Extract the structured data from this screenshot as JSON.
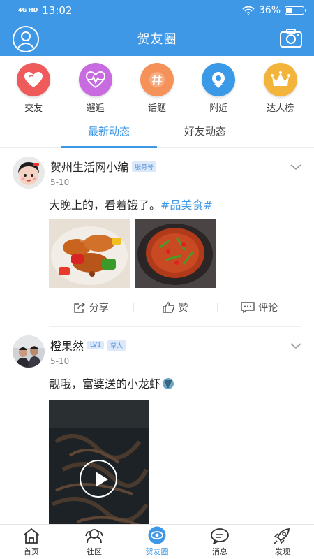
{
  "status_bar": {
    "network": "4G HD",
    "time": "13:02",
    "battery": "36%",
    "battery_level": 0.36
  },
  "header": {
    "title": "贺友圈",
    "profile_icon": "user-circle-icon",
    "camera_icon": "camera-icon"
  },
  "categories": [
    {
      "label": "交友",
      "icon": "heart-icon",
      "color": "#ef5a5a"
    },
    {
      "label": "邂逅",
      "icon": "heartbeat-icon",
      "color": "#c86be0"
    },
    {
      "label": "话题",
      "icon": "hashtag-icon",
      "color": "#f5925a"
    },
    {
      "label": "附近",
      "icon": "location-icon",
      "color": "#3a9ae8"
    },
    {
      "label": "达人榜",
      "icon": "crown-icon",
      "color": "#f3b43b"
    }
  ],
  "tabs": [
    {
      "label": "最新动态",
      "active": true
    },
    {
      "label": "好友动态",
      "active": false
    }
  ],
  "posts": [
    {
      "name": "贺州生活网小编",
      "tag": "服务号",
      "date": "5-10",
      "text": "大晚上的，看着饿了。",
      "hashtag": "#品美食#",
      "actions": {
        "share": "分享",
        "like": "赞",
        "comment": "评论"
      }
    },
    {
      "name": "橙果然",
      "tags": [
        "LV1",
        "草人"
      ],
      "date": "5-10",
      "text": "靓哦，富婆送的小龙虾"
    }
  ],
  "bottom_nav": [
    {
      "label": "首页",
      "icon": "home-icon",
      "active": false
    },
    {
      "label": "社区",
      "icon": "community-icon",
      "active": false
    },
    {
      "label": "贺友圈",
      "icon": "eye-circle-icon",
      "active": true
    },
    {
      "label": "消息",
      "icon": "message-icon",
      "active": false
    },
    {
      "label": "发现",
      "icon": "rocket-icon",
      "active": false
    }
  ]
}
